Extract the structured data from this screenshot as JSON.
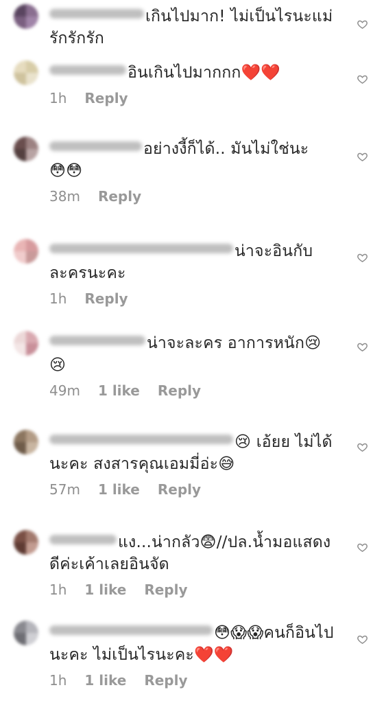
{
  "icons": {
    "like": "heart-outline-icon"
  },
  "colors": {
    "meta_text": "#8e8e8e",
    "text": "#262626"
  },
  "comments": [
    {
      "text": "เกินไปมาก! ไม่เป็นไรนะแม่ รักรักรัก",
      "time": "",
      "likes": "",
      "reply": "",
      "avatar": [
        "#5a4560",
        "#8a6e90",
        "#7a5f80",
        "#a084a8"
      ]
    },
    {
      "text": "อินเกินไปมากกก❤️❤️",
      "time": "1h",
      "likes": "",
      "reply": "Reply",
      "avatar": [
        "#e6dcbf",
        "#d8cda8",
        "#cfc39e",
        "#e9e2cc"
      ]
    },
    {
      "text": "อย่างงี้ก็ได้.. มันไม่ใช่นะ😳😳",
      "time": "38m",
      "likes": "",
      "reply": "Reply",
      "avatar": [
        "#6a4e4e",
        "#9c8282",
        "#54403f",
        "#b8a3a3"
      ]
    },
    {
      "text": "น่าจะอินกับละครนะคะ",
      "time": "1h",
      "likes": "",
      "reply": "Reply",
      "avatar": [
        "#e9b5b5",
        "#d79b9e",
        "#f0cccc",
        "#c99a9a"
      ]
    },
    {
      "text": "น่าจะละคร อาการหนัก😢😢",
      "time": "49m",
      "likes": "1 like",
      "reply": "Reply",
      "avatar": [
        "#ecd8d8",
        "#d9a9b0",
        "#f3e6e6",
        "#c9909a"
      ]
    },
    {
      "text": "😢 เอ้ยย ไม่ได้นะคะ สงสารคุณเอมมี่อ่ะ😅",
      "time": "57m",
      "likes": "1 like",
      "reply": "Reply",
      "avatar": [
        "#8c7660",
        "#b39c86",
        "#6f5c4a",
        "#c8b5a1"
      ]
    },
    {
      "text": "แง...น่ากลัว😨//ปล.น้ำมอแสดงดีค่ะเค้าเลยอินจัด",
      "time": "1h",
      "likes": "1 like",
      "reply": "Reply",
      "avatar": [
        "#7a4f45",
        "#a37a6e",
        "#5f3b33",
        "#c29b90"
      ]
    },
    {
      "text": "😳😱😱คนก็อินไปนะคะ ไม่เป็นไรนะคะ❤️❤️",
      "time": "1h",
      "likes": "1 like",
      "reply": "Reply",
      "avatar": [
        "#8a8a90",
        "#b5b5bb",
        "#6e6e74",
        "#cfcfd4"
      ]
    }
  ]
}
